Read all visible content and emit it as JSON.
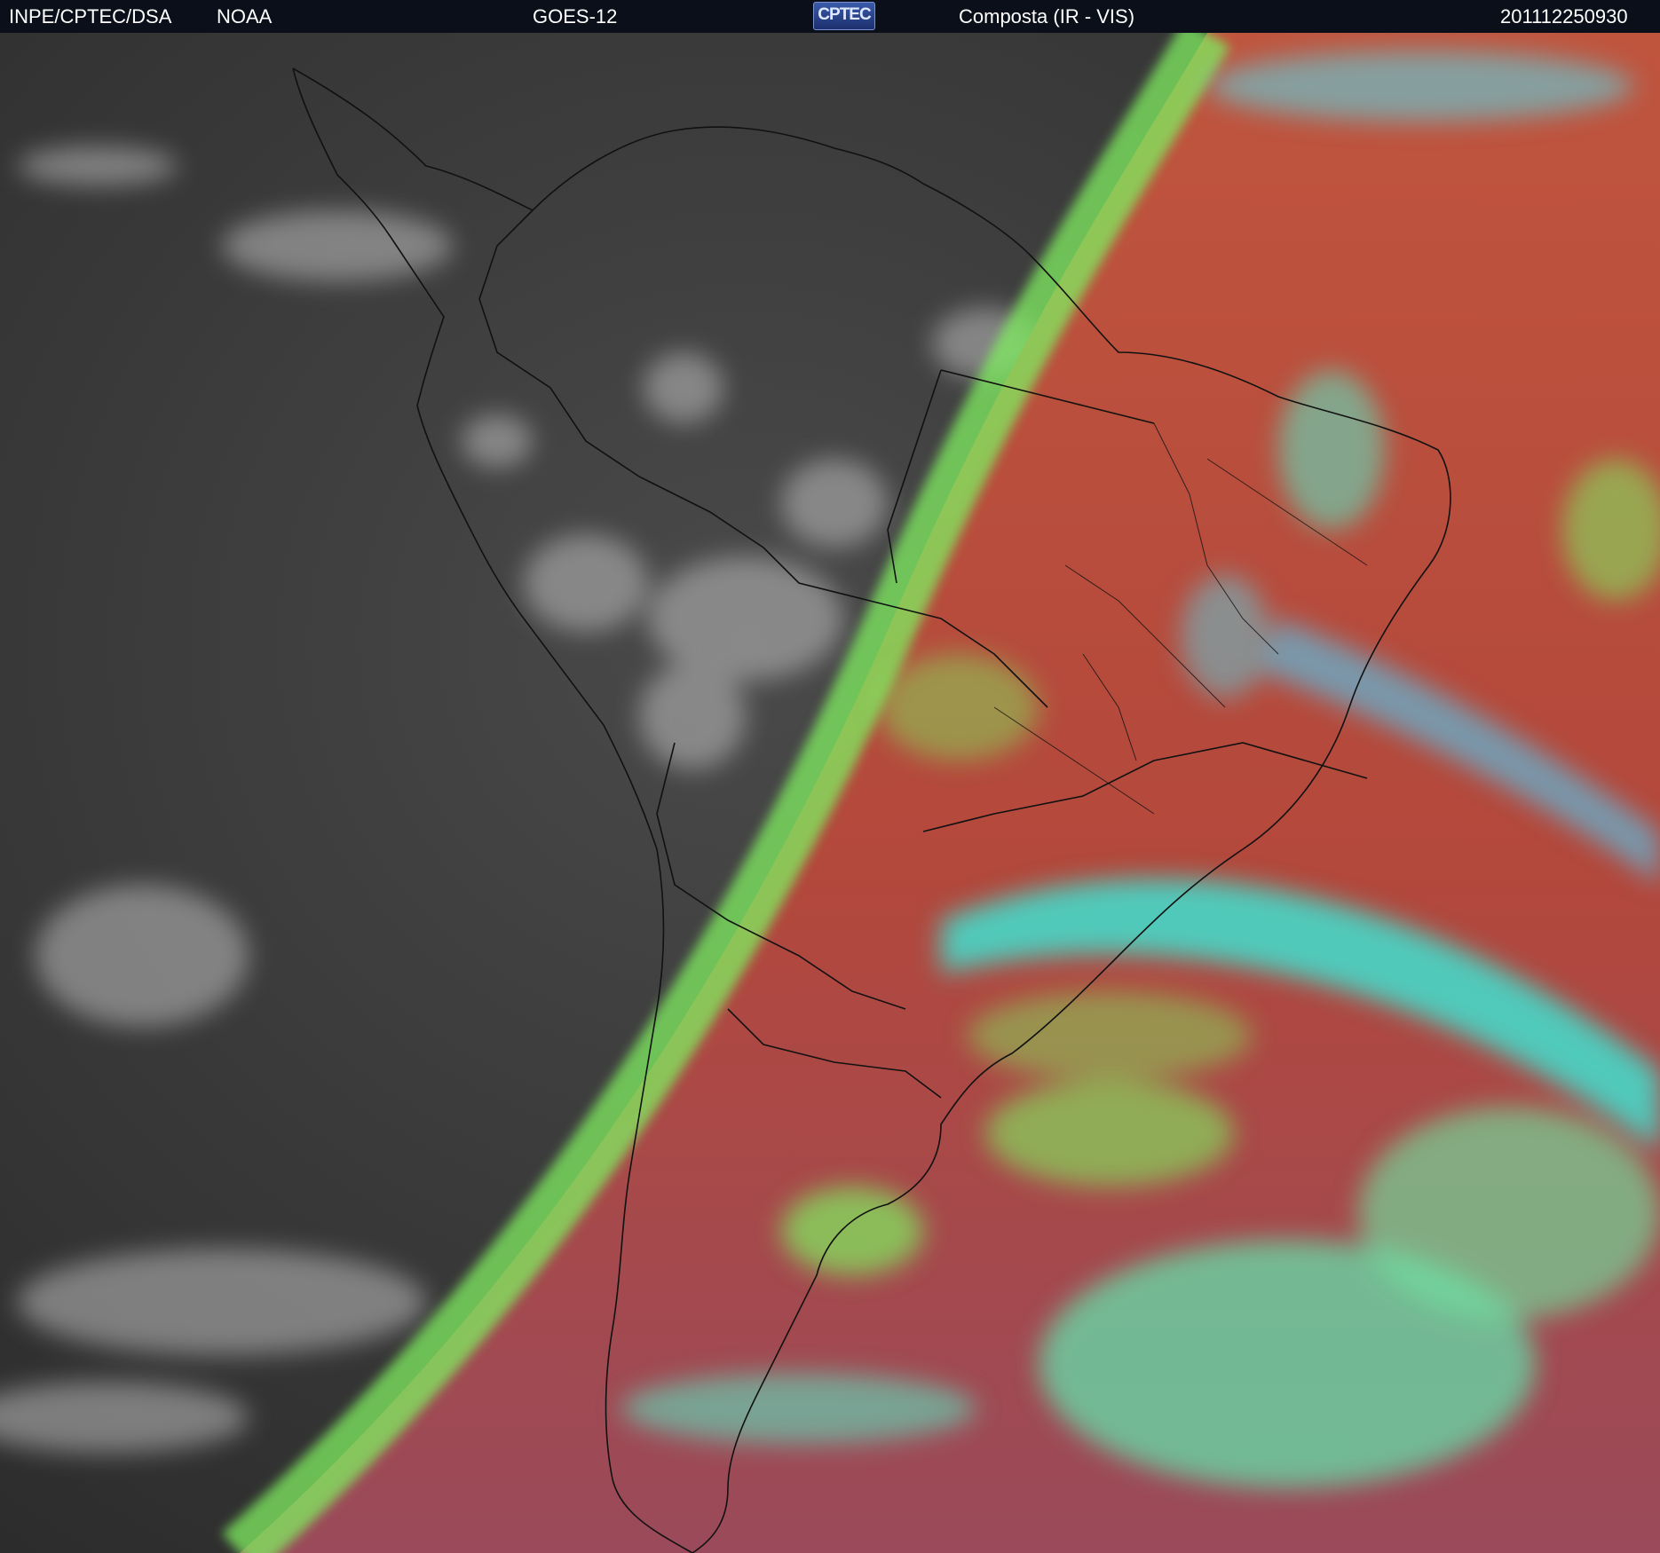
{
  "header": {
    "org": "INPE/CPTEC/DSA",
    "agency": "NOAA",
    "satellite": "GOES-12",
    "logo_text": "CPTEC",
    "product": "Composta (IR - VIS)",
    "timestamp": "201112250930"
  },
  "colors": {
    "header_bg": "#0a0f1a",
    "night_gray": "#3a3a3a",
    "day_red": "#b84a3e",
    "cloud_cyan": "#40e0d0",
    "cloud_green": "#80f060"
  },
  "map": {
    "icons": [
      "satellite-image",
      "terminator-line",
      "country-borders",
      "state-borders"
    ]
  }
}
